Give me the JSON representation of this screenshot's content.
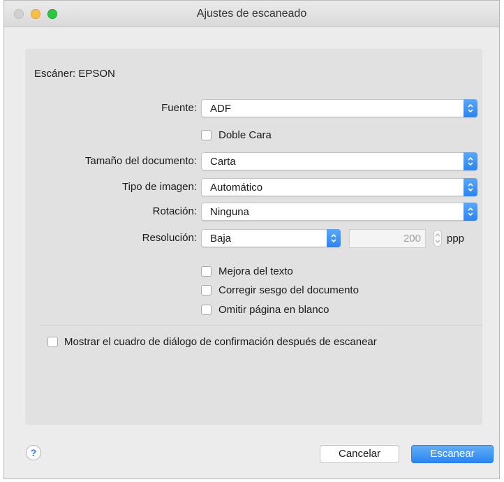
{
  "window": {
    "title": "Ajustes de escaneado"
  },
  "scanner": {
    "label": "Escáner: EPSON"
  },
  "form": {
    "source": {
      "label": "Fuente:",
      "value": "ADF"
    },
    "duplex": {
      "label": "Doble Cara",
      "checked": false
    },
    "doc_size": {
      "label": "Tamaño del documento:",
      "value": "Carta"
    },
    "image_type": {
      "label": "Tipo de imagen:",
      "value": "Automático"
    },
    "rotation": {
      "label": "Rotación:",
      "value": "Ninguna"
    },
    "resolution": {
      "label": "Resolución:",
      "value": "Baja",
      "dpi": "200",
      "unit": "ppp"
    },
    "options": [
      {
        "label": "Mejora del texto",
        "checked": false
      },
      {
        "label": "Corregir sesgo del documento",
        "checked": false
      },
      {
        "label": "Omitir página en blanco",
        "checked": false
      }
    ],
    "confirm": {
      "label": "Mostrar el cuadro de diálogo de confirmación después de escanear",
      "checked": false
    }
  },
  "footer": {
    "help": "?",
    "cancel_label": "Cancelar",
    "scan_label": "Escanear"
  },
  "colors": {
    "accent": "#2d84f0",
    "panel": "#e1e1e1",
    "window": "#ececec"
  },
  "icons": {
    "help": "question-mark-icon",
    "select_arrow": "updown-chevron-icon"
  }
}
